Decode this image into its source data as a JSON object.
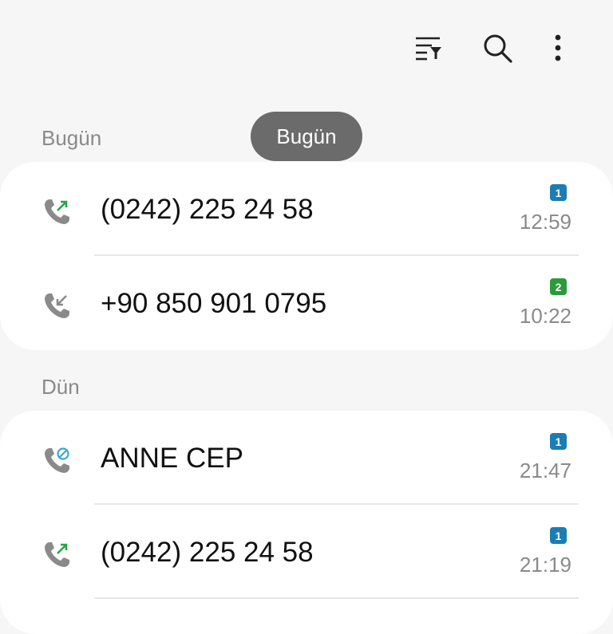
{
  "toolbar": {
    "filter_icon": "filter-list-icon",
    "search_icon": "search-icon",
    "more_icon": "more-vert-icon"
  },
  "toast": {
    "text": "Bugün"
  },
  "colors": {
    "sim1": "#1a7db3",
    "sim2": "#2a9a3a",
    "outgoing_arrow": "#27a845",
    "incoming_arrow": "#8a8a8a",
    "blocked": "#3aa7d8"
  },
  "sections": [
    {
      "label": "Bugün",
      "calls": [
        {
          "name": "(0242) 225 24 58",
          "sim": "1",
          "time": "12:59",
          "type": "outgoing"
        },
        {
          "name": "+90 850 901 0795",
          "sim": "2",
          "time": "10:22",
          "type": "incoming"
        }
      ]
    },
    {
      "label": "Dün",
      "calls": [
        {
          "name": "ANNE CEP",
          "sim": "1",
          "time": "21:47",
          "type": "blocked"
        },
        {
          "name": "(0242) 225 24 58",
          "sim": "1",
          "time": "21:19",
          "type": "outgoing"
        }
      ]
    }
  ]
}
